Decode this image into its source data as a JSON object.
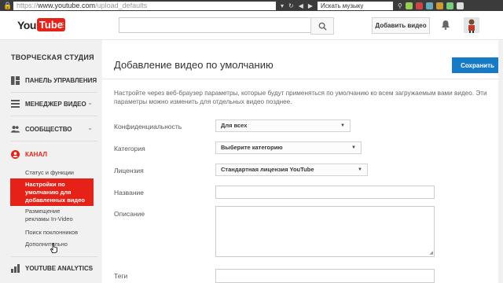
{
  "browser": {
    "url_prefix": "https://",
    "url_main": "www.youtube.com",
    "url_path": "/upload_defaults",
    "search_placeholder": "Искать музыку",
    "lock_icon": "lock-icon",
    "colors": {
      "chrome": "#3b3b3b"
    }
  },
  "header": {
    "logo_you": "You",
    "logo_tube": "Tube",
    "search_value": "",
    "upload_label": "Добавить видео",
    "icons": [
      "search-icon",
      "bell-icon",
      "avatar"
    ]
  },
  "sidebar": {
    "studio_title": "ТВОРЧЕСКАЯ СТУДИЯ",
    "nav": {
      "dashboard": "ПАНЕЛЬ УПРАВЛЕНИЯ",
      "video_manager": "МЕНЕДЖЕР ВИДЕО",
      "community": "СООБЩЕСТВО",
      "channel": "КАНАЛ",
      "analytics": "YOUTUBE ANALYTICS"
    },
    "channel_items": {
      "status": "Статус и функции",
      "upload_defaults_1": "Настройки по",
      "upload_defaults_2": "умолчанию для",
      "upload_defaults_3": "добавленных видео",
      "invideo_1": "Размещение",
      "invideo_2": "рекламы In-Video",
      "fan_finder": "Поиск поклонников",
      "advanced": "Дополнительно"
    },
    "colors": {
      "active": "#e62117",
      "background": "#f1f1f1"
    }
  },
  "main": {
    "title": "Добавление видео по умолчанию",
    "save_label": "Сохранить",
    "description": "Настройте через веб-браузер параметры, которые будут применяться по умолчанию ко всем загружаемым вами видео. Эти параметры можно изменить для отдельных видео позднее.",
    "privacy": {
      "label": "Конфиденциальность",
      "value": "Для всех"
    },
    "category": {
      "label": "Категория",
      "value": "Выберите категорию"
    },
    "license": {
      "label": "Лицензия",
      "value": "Стандартная лицензия YouTube"
    },
    "name": {
      "label": "Название",
      "value": ""
    },
    "description_field": {
      "label": "Описание",
      "value": ""
    },
    "tags": {
      "label": "Теги",
      "value": ""
    },
    "colors": {
      "save_button": "#167ac6"
    }
  }
}
